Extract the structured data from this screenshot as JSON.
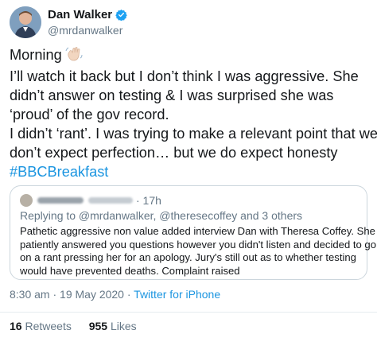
{
  "author": {
    "display_name": "Dan Walker",
    "handle": "@mrdanwalker",
    "verified_icon": "verified-badge-icon"
  },
  "tweet": {
    "lines": [
      "Morning",
      "I’ll watch it back but I don’t think I was aggressive. She",
      "didn’t answer on testing & I was surprised she was",
      "‘proud’ of the  gov record.",
      "I didn’t ‘rant’. I was trying to make a relevant point that we",
      "don’t expect perfection… but we do expect honesty"
    ],
    "emoji": "waving-hand-icon",
    "hashtag": "#BBCBreakfast"
  },
  "quoted": {
    "time": "· 17h",
    "replying_to": "Replying to @mrdanwalker, @theresecoffey and 3 others",
    "text_lines": [
      "Pathetic aggressive non value added interview Dan with Theresa Coffey. She",
      "patiently answered you questions however you didn't listen and decided to go",
      "on a rant pressing her for an apology. Jury's still out as to whether testing",
      "would have prevented deaths. Complaint raised"
    ]
  },
  "meta": {
    "timestamp": "8:30 am · 19 May 2020 · ",
    "source": "Twitter for iPhone"
  },
  "stats": {
    "retweets_count": "16",
    "retweets_label": "Retweets",
    "likes_count": "955",
    "likes_label": "Likes"
  },
  "colors": {
    "link": "#1b95e0",
    "secondary_text": "#657786",
    "border": "#ccd6dd"
  }
}
